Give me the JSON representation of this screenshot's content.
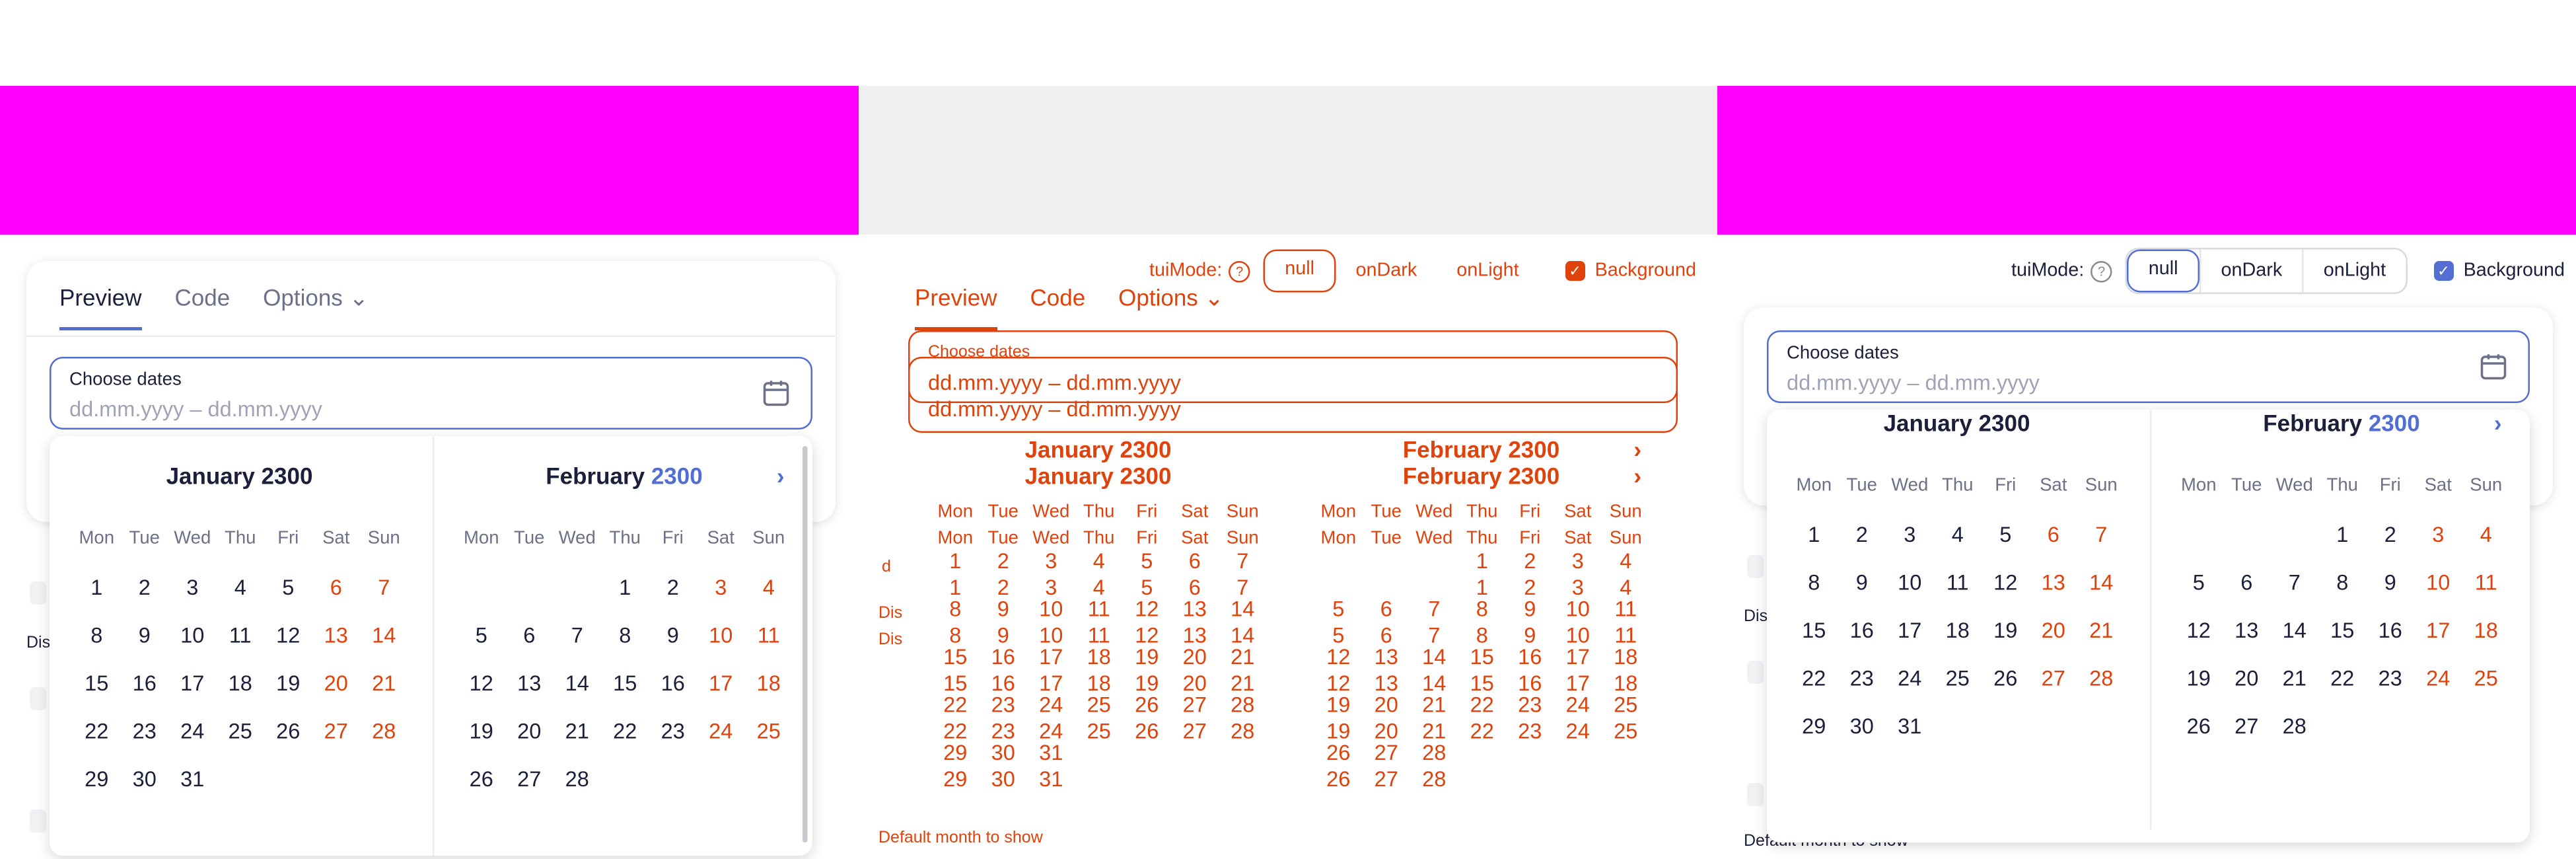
{
  "mode_label": "tuiMode:",
  "modes": [
    "null",
    "onDark",
    "onLight"
  ],
  "background_label": "Background",
  "tabs": {
    "preview": "Preview",
    "code": "Code",
    "options": "Options"
  },
  "input": {
    "label": "Choose dates",
    "placeholder": "dd.mm.yyyy – dd.mm.yyyy"
  },
  "weekdays": [
    "Mon",
    "Tue",
    "Wed",
    "Thu",
    "Fri",
    "Sat",
    "Sun"
  ],
  "months": [
    {
      "name": "January",
      "year": "2300",
      "first_weekday": 0,
      "days": 31
    },
    {
      "name": "February",
      "year": "2300",
      "first_weekday": 3,
      "days": 28
    }
  ],
  "bg_texts": {
    "dis": "Dis",
    "default_month": "Default month to show"
  },
  "colors": {
    "accent": "#526ed3",
    "weekend": "#e0420c",
    "magenta": "#ff00ff",
    "debug": "#e0420c"
  }
}
